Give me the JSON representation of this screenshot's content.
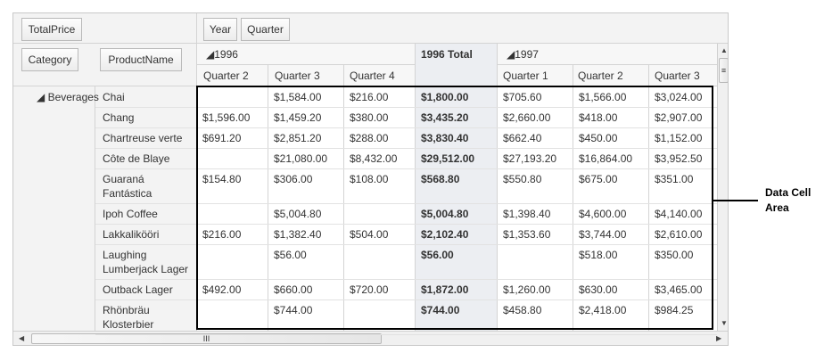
{
  "fields": {
    "data_field": "TotalPrice",
    "column_fields": [
      "Year",
      "Quarter"
    ],
    "row_fields": [
      "Category",
      "ProductName"
    ]
  },
  "columns": {
    "year_1996": "◢1996",
    "year_1996_total": "1996 Total",
    "year_1997": "◢1997",
    "quarters": [
      "Quarter 2",
      "Quarter 3",
      "Quarter 4",
      "",
      "Quarter 1",
      "Quarter 2",
      "Quarter 3"
    ]
  },
  "category": "◢ Beverages",
  "rows": [
    {
      "product": "Chai",
      "values": [
        "",
        "$1,584.00",
        "$216.00",
        "$1,800.00",
        "$705.60",
        "$1,566.00",
        "$3,024.00"
      ]
    },
    {
      "product": "Chang",
      "values": [
        "$1,596.00",
        "$1,459.20",
        "$380.00",
        "$3,435.20",
        "$2,660.00",
        "$418.00",
        "$2,907.00"
      ]
    },
    {
      "product": "Chartreuse verte",
      "values": [
        "$691.20",
        "$2,851.20",
        "$288.00",
        "$3,830.40",
        "$662.40",
        "$450.00",
        "$1,152.00"
      ]
    },
    {
      "product": "Côte de Blaye",
      "values": [
        "",
        "$21,080.00",
        "$8,432.00",
        "$29,512.00",
        "$27,193.20",
        "$16,864.00",
        "$3,952.50"
      ]
    },
    {
      "product": "Guaraná Fantástica",
      "values": [
        "$154.80",
        "$306.00",
        "$108.00",
        "$568.80",
        "$550.80",
        "$675.00",
        "$351.00"
      ]
    },
    {
      "product": "Ipoh Coffee",
      "values": [
        "",
        "$5,004.80",
        "",
        "$5,004.80",
        "$1,398.40",
        "$4,600.00",
        "$4,140.00"
      ]
    },
    {
      "product": "Lakkalikööri",
      "values": [
        "$216.00",
        "$1,382.40",
        "$504.00",
        "$2,102.40",
        "$1,353.60",
        "$3,744.00",
        "$2,610.00"
      ]
    },
    {
      "product": "Laughing Lumberjack Lager",
      "values": [
        "",
        "$56.00",
        "",
        "$56.00",
        "",
        "$518.00",
        "$350.00"
      ]
    },
    {
      "product": "Outback Lager",
      "values": [
        "$492.00",
        "$660.00",
        "$720.00",
        "$1,872.00",
        "$1,260.00",
        "$630.00",
        "$3,465.00"
      ]
    },
    {
      "product": "Rhönbräu Klosterbier",
      "values": [
        "",
        "$744.00",
        "",
        "$744.00",
        "$458.80",
        "$2,418.00",
        "$984.25"
      ]
    }
  ],
  "scroll": {
    "h_thumb_label": "III",
    "v_thumb_label": "≡"
  },
  "annotation": {
    "line1": "Data Cell",
    "line2": "Area"
  }
}
